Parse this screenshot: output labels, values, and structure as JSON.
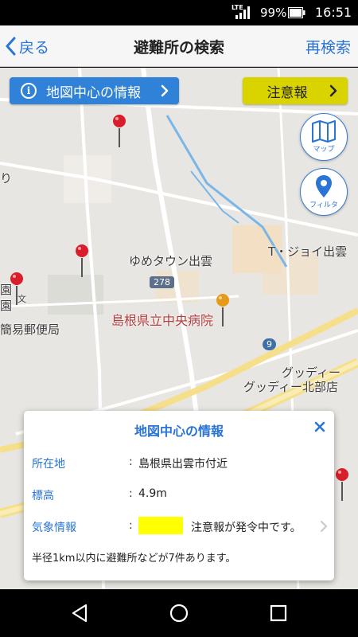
{
  "status_bar": {
    "network": "LTE",
    "battery_percent": "99%",
    "time": "16:51"
  },
  "nav": {
    "back_label": "戻る",
    "title": "避難所の検索",
    "right_label": "再検索"
  },
  "map": {
    "info_button_label": "地図中心の情報",
    "warning_button_label": "注意報",
    "map_button_label": "マップ",
    "filter_button_label": "フィルタ",
    "places": {
      "yume_town": "ゆめタウン出雲",
      "t_joy": "T・ジョイ出雲",
      "hospital": "島根県立中央病院",
      "post_office": "簡易郵便局",
      "gooday": "グッディー",
      "gooday_north": "グッディー北部店",
      "route_278": "278",
      "route_9": "9",
      "partial_ri": "り",
      "partial_en1": "園",
      "partial_en2": "園",
      "partial_bun": "文"
    },
    "colors": {
      "pin_red": "#d81e2b",
      "pin_orange": "#e59a1a",
      "accent_blue": "#2a74d6",
      "warning_yellow": "#d9d400"
    }
  },
  "panel": {
    "title": "地図中心の情報",
    "rows": [
      {
        "key": "所在地",
        "value": "島根県出雲市付近"
      },
      {
        "key": "標高",
        "value": "4.9m"
      },
      {
        "key": "気象情報",
        "value": "注意報が発令中です。"
      }
    ],
    "weather_color": "#ffff00",
    "footer": "半径1km以内に避難所などが7件あります。"
  }
}
